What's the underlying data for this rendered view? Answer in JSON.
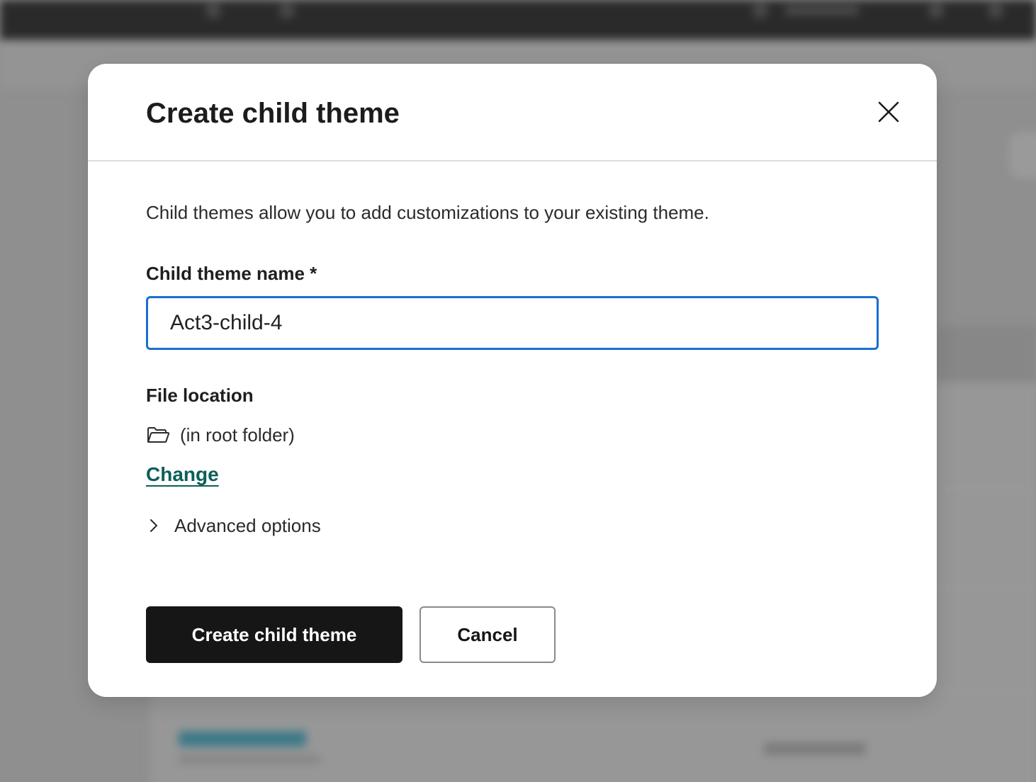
{
  "modal": {
    "title": "Create child theme",
    "description": "Child themes allow you to add customizations to your existing theme.",
    "name_field": {
      "label": "Child theme name *",
      "value": "Act3-child-4"
    },
    "file_location": {
      "label": "File location",
      "value": "(in root folder)",
      "change_label": "Change"
    },
    "advanced_options_label": "Advanced options",
    "primary_button_label": "Create child theme",
    "cancel_button_label": "Cancel"
  },
  "icons": {
    "close": "close-icon",
    "folder": "folder-open-icon",
    "chevron": "chevron-right-icon"
  },
  "colors": {
    "input_focus": "#1a6fcf",
    "link": "#0b5f59",
    "primary_button": "#161616"
  }
}
